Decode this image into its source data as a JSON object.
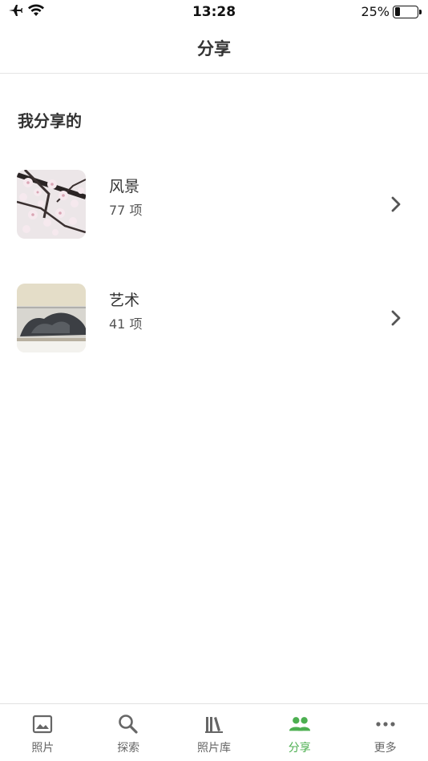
{
  "status_bar": {
    "time": "13:28",
    "battery_percent": "25%",
    "battery_level": 0.25,
    "icons": [
      "airplane-icon",
      "wifi-icon",
      "battery-icon"
    ]
  },
  "nav": {
    "title": "分享"
  },
  "section": {
    "title": "我分享的"
  },
  "albums": [
    {
      "name": "风景",
      "count": "77 项",
      "thumb_icon": "cherry-blossom-thumbnail"
    },
    {
      "name": "艺术",
      "count": "41 项",
      "thumb_icon": "ink-painting-thumbnail"
    }
  ],
  "tab_bar": {
    "active_color": "#4caf50",
    "inactive_color": "#666666",
    "tabs": [
      {
        "label": "照片",
        "icon": "photo-icon"
      },
      {
        "label": "探索",
        "icon": "search-icon"
      },
      {
        "label": "照片库",
        "icon": "library-icon"
      },
      {
        "label": "分享",
        "icon": "people-icon",
        "active": true
      },
      {
        "label": "更多",
        "icon": "more-icon"
      }
    ]
  }
}
